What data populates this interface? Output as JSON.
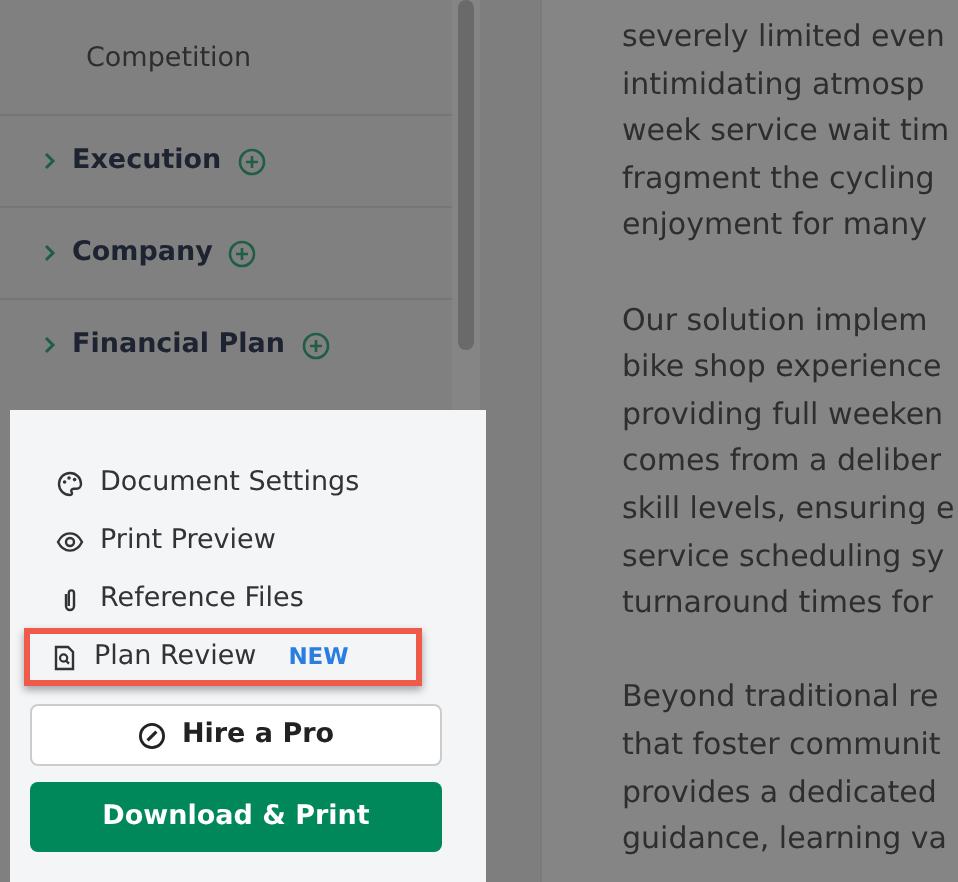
{
  "sidebar": {
    "subitems": [
      "Competition"
    ],
    "sections": [
      {
        "label": "Execution"
      },
      {
        "label": "Company"
      },
      {
        "label": "Financial Plan"
      }
    ]
  },
  "panel": {
    "items": [
      {
        "kind": "palette",
        "label": "Document Settings",
        "highlighted": false
      },
      {
        "kind": "eye",
        "label": "Print Preview",
        "highlighted": false
      },
      {
        "kind": "clip",
        "label": "Reference Files",
        "highlighted": false
      },
      {
        "kind": "review",
        "label": "Plan Review",
        "badge": "NEW",
        "highlighted": true
      }
    ],
    "hire_button": "Hire a Pro",
    "download_button": "Download & Print"
  },
  "content": {
    "paragraphs": [
      [
        "severely limited even",
        "intimidating atmosp",
        "week service wait tim",
        "fragment the cycling",
        "enjoyment for many"
      ],
      [
        "Our solution implem",
        "bike shop experience",
        "providing full weeken",
        "comes from a deliber",
        "skill levels, ensuring e",
        "service scheduling sy",
        "turnaround times for"
      ],
      [
        "Beyond traditional re",
        "that foster communit",
        "provides a dedicated",
        "guidance, learning va"
      ]
    ]
  }
}
